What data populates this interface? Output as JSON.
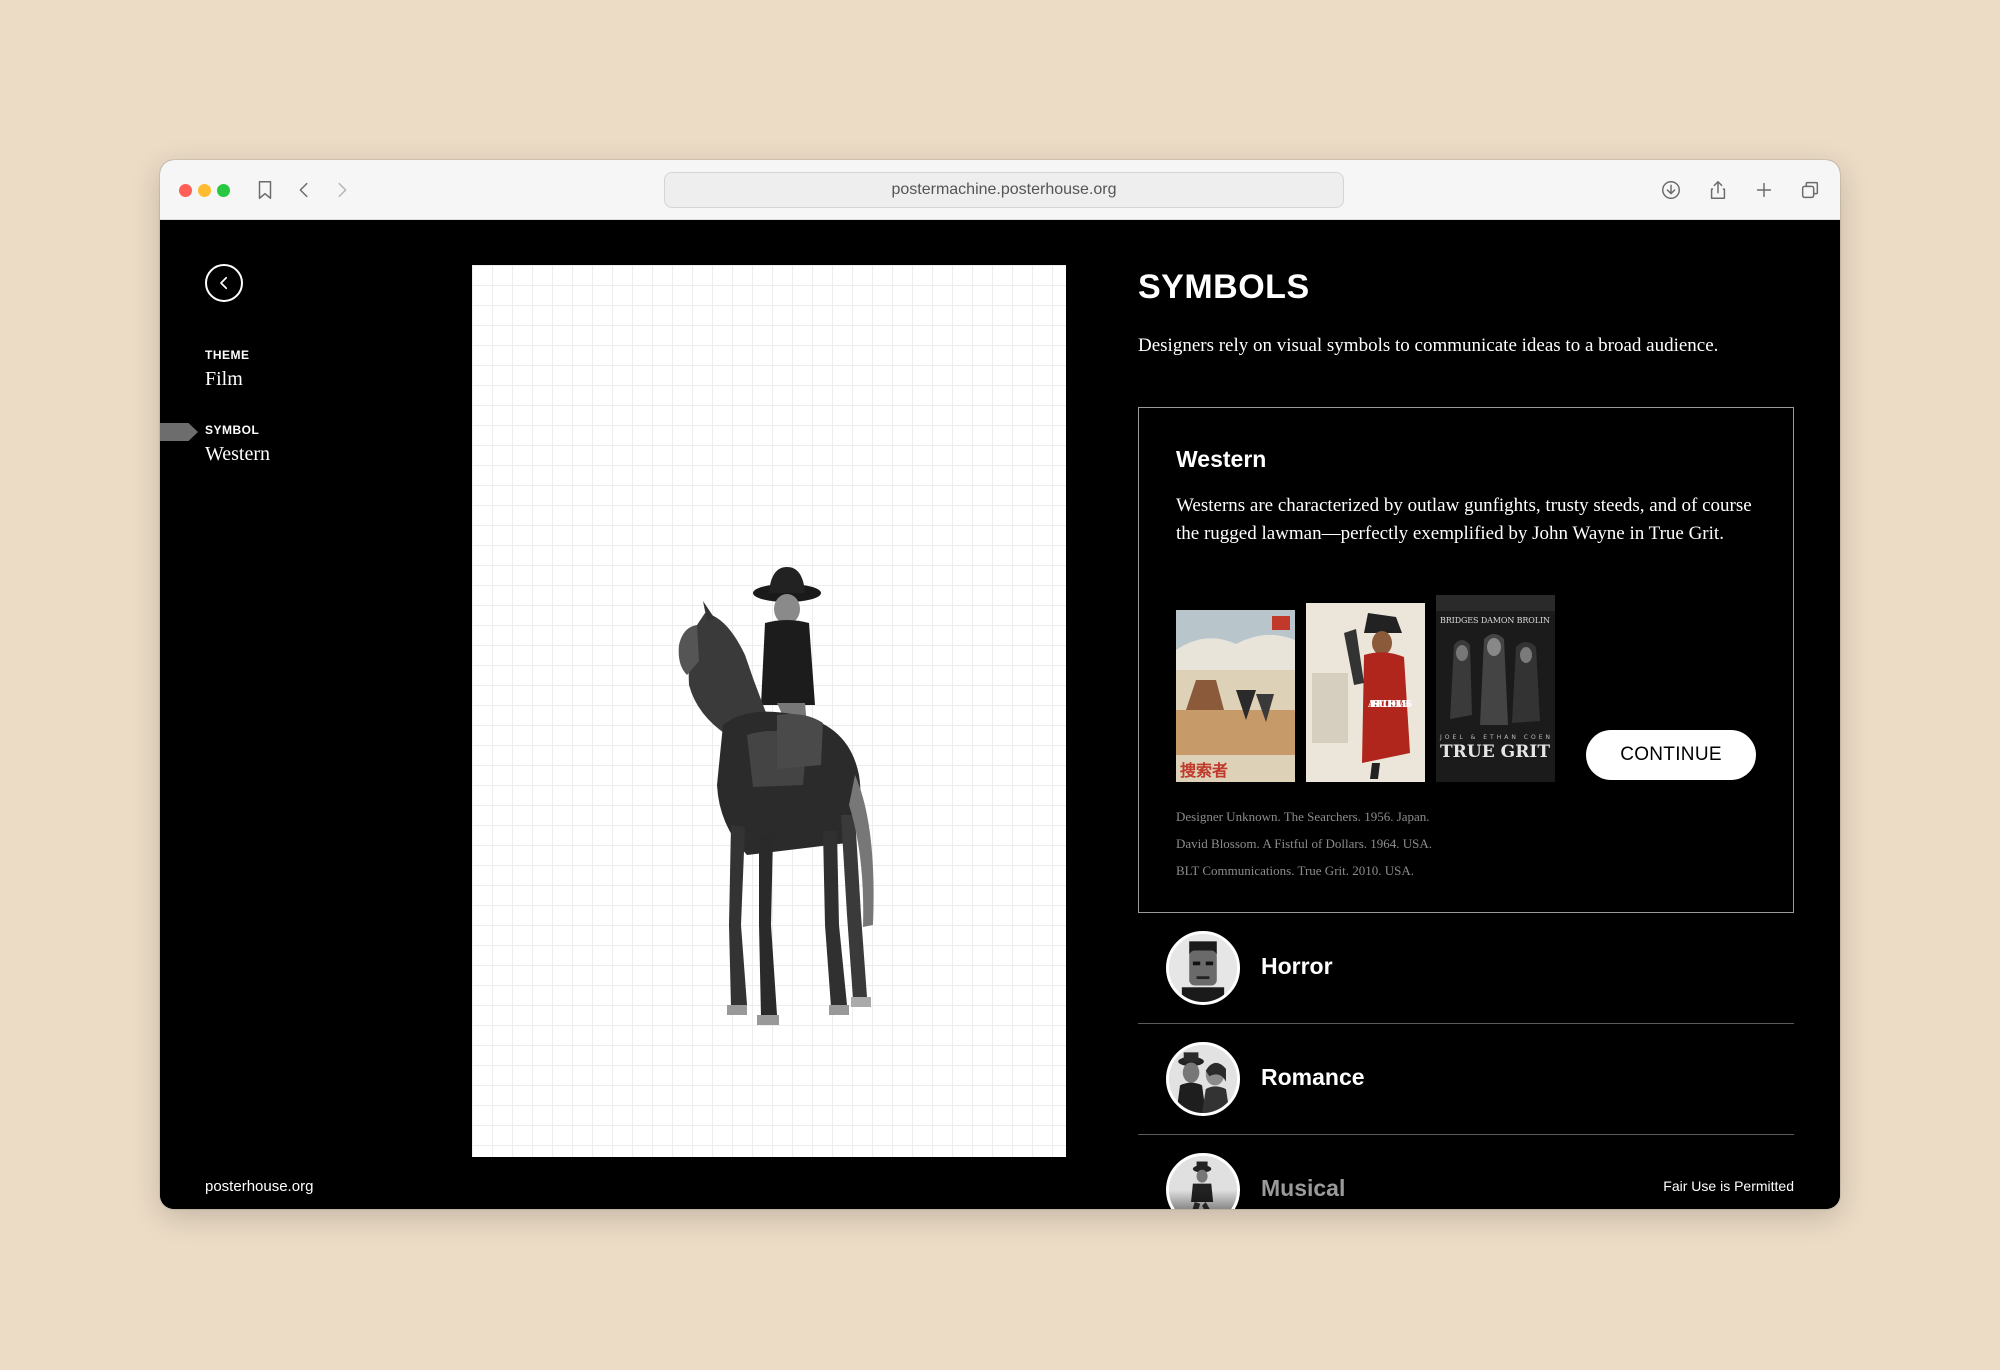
{
  "browser": {
    "url": "postermachine.posterhouse.org"
  },
  "sidebar": {
    "theme_label": "THEME",
    "theme_value": "Film",
    "symbol_label": "SYMBOL",
    "symbol_value": "Western",
    "footer_link": "posterhouse.org"
  },
  "panel": {
    "title": "SYMBOLS",
    "description": "Designers rely on visual symbols to communicate ideas to a broad audience.",
    "card": {
      "title": "Western",
      "text": "Westerns are characterized by outlaw gunfights, trusty steeds, and of course the rugged lawman—perfectly exemplified by John Wayne in True Grit.",
      "continue_label": "CONTINUE",
      "thumbnails": [
        {
          "name": "the-searchers-poster",
          "caption": "捜索者"
        },
        {
          "name": "a-fistful-of-dollars-poster",
          "caption": "A FISTFUL OF DOLLARS"
        },
        {
          "name": "true-grit-poster",
          "caption": "TRUE GRIT",
          "top_text": "BRIDGES DAMON BROLIN",
          "sub_text": "JOEL & ETHAN COEN"
        }
      ],
      "credits": [
        "Designer Unknown. The Searchers. 1956. Japan.",
        "David Blossom. A Fistful of Dollars. 1964. USA.",
        "BLT Communications. True Grit. 2010. USA."
      ]
    },
    "categories": [
      {
        "label": "Horror",
        "icon": "frankenstein-avatar"
      },
      {
        "label": "Romance",
        "icon": "couple-avatar"
      },
      {
        "label": "Musical",
        "icon": "dancer-avatar"
      }
    ],
    "footer_note": "Fair Use is Permitted"
  },
  "colors": {
    "page_background": "#ecdcc6",
    "app_background": "#000000",
    "text": "#ffffff",
    "muted": "#8c8c8c"
  }
}
